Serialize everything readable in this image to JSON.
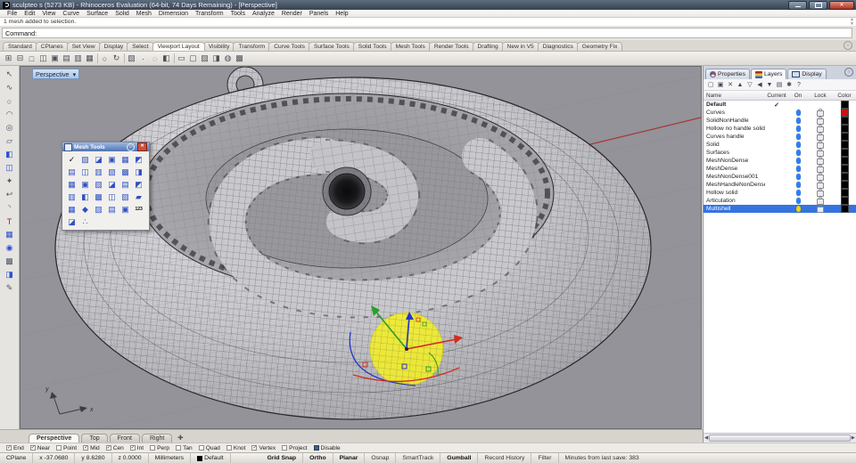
{
  "colors": {
    "selection": "#3574e0",
    "bulb-blue": "#2e7ff0",
    "bulb-yellow": "#ffd400",
    "axis-red": "#a83535",
    "gumball-red": "#d42a1e",
    "gumball-green": "#2a9e2a",
    "gumball-blue": "#2636c8",
    "gumball-yellow": "#f4ef27"
  },
  "window": {
    "title": "sculpteo s (5273 KB) - Rhinoceros Evaluation (64-bit, 74 Days Remaining) - [Perspective]"
  },
  "menu": {
    "items": [
      "File",
      "Edit",
      "View",
      "Curve",
      "Surface",
      "Solid",
      "Mesh",
      "Dimension",
      "Transform",
      "Tools",
      "Analyze",
      "Render",
      "Panels",
      "Help"
    ]
  },
  "command": {
    "history": "1 mesh added to selection.",
    "prompt": "Command:"
  },
  "toolbar_tabs": {
    "items": [
      {
        "label": "Standard"
      },
      {
        "label": "CPlanes"
      },
      {
        "label": "Set View"
      },
      {
        "label": "Display"
      },
      {
        "label": "Select"
      },
      {
        "label": "Viewport Layout",
        "active": true
      },
      {
        "label": "Visibility"
      },
      {
        "label": "Transform"
      },
      {
        "label": "Curve Tools"
      },
      {
        "label": "Surface Tools"
      },
      {
        "label": "Solid Tools"
      },
      {
        "label": "Mesh Tools"
      },
      {
        "label": "Render Tools"
      },
      {
        "label": "Drafting"
      },
      {
        "label": "New in V5"
      },
      {
        "label": "Diagnostics"
      },
      {
        "label": "Geometry Fix"
      }
    ]
  },
  "main_toolbar": {
    "icons": [
      {
        "name": "viewport-layout-4-icon",
        "glyph": "⊞"
      },
      {
        "name": "viewport-layout-3-icon",
        "glyph": "⊟"
      },
      {
        "name": "viewport-single-icon",
        "glyph": "□"
      },
      {
        "name": "viewport-split-vertical-icon",
        "glyph": "◫"
      },
      {
        "name": "viewport-config-icon",
        "glyph": "▣"
      },
      {
        "name": "viewport-rows-icon",
        "glyph": "▤"
      },
      {
        "name": "viewport-columns-icon",
        "glyph": "▥"
      },
      {
        "name": "viewport-grid-icon",
        "glyph": "▦"
      },
      {
        "sep": true
      },
      {
        "name": "shaded-view-icon",
        "glyph": "○"
      },
      {
        "name": "rotate-view-icon",
        "glyph": "↻"
      },
      {
        "sep": true
      },
      {
        "name": "background-image-icon",
        "glyph": "▧"
      },
      {
        "name": "point-icon",
        "glyph": "·"
      },
      {
        "name": "lens-icon",
        "glyph": "◌"
      },
      {
        "name": "camera-icon",
        "glyph": "◧"
      },
      {
        "sep": true
      },
      {
        "name": "named-view-icon",
        "glyph": "▭"
      },
      {
        "name": "new-viewport-icon",
        "glyph": "▢"
      },
      {
        "name": "plan-view-icon",
        "glyph": "▨"
      },
      {
        "name": "page-setup-icon",
        "glyph": "◨"
      },
      {
        "name": "zoom-lens-icon",
        "glyph": "◍"
      },
      {
        "name": "print-icon",
        "glyph": "▩"
      }
    ]
  },
  "left_toolbar": {
    "icons": [
      {
        "name": "select-arrow-icon",
        "glyph": "↖"
      },
      {
        "name": "control-point-curve-icon",
        "glyph": "∿"
      },
      {
        "name": "circle-icon",
        "glyph": "○"
      },
      {
        "name": "arc-icon",
        "glyph": "◠"
      },
      {
        "name": "ellipse-icon",
        "glyph": "◎"
      },
      {
        "name": "surface-icon",
        "glyph": "▱"
      },
      {
        "name": "box-icon",
        "glyph": "◧",
        "blue": true
      },
      {
        "name": "cylinder-icon",
        "glyph": "◫",
        "blue": true
      },
      {
        "name": "extrude-icon",
        "glyph": "✦"
      },
      {
        "name": "join-icon",
        "glyph": "↩"
      },
      {
        "name": "blend-arc-icon",
        "glyph": "◝"
      },
      {
        "name": "text-icon",
        "glyph": "T",
        "red": true
      },
      {
        "name": "mesh-icon",
        "glyph": "▦",
        "blue": true
      },
      {
        "name": "render-sphere-icon",
        "glyph": "◉",
        "blue": true
      },
      {
        "name": "grid-icon",
        "glyph": "▩"
      },
      {
        "name": "solid-tools-icon",
        "glyph": "◨",
        "blue": true
      },
      {
        "name": "annotate-icon",
        "glyph": "✎"
      }
    ]
  },
  "viewport": {
    "label": "Perspective",
    "dropdown_glyph": "▾",
    "tabs": [
      {
        "label": "Perspective",
        "active": true
      },
      {
        "label": "Top"
      },
      {
        "label": "Front"
      },
      {
        "label": "Right"
      }
    ],
    "nav_glyph": "✚"
  },
  "mesh_palette": {
    "title": "Mesh Tools",
    "icons": [
      {
        "glyph": "✓",
        "black": true
      },
      {
        "glyph": "▨"
      },
      {
        "glyph": "◪"
      },
      {
        "glyph": "▣"
      },
      {
        "glyph": "▦"
      },
      {
        "glyph": "◩"
      },
      {
        "glyph": "▤"
      },
      {
        "glyph": "◫"
      },
      {
        "glyph": "▥"
      },
      {
        "glyph": "▧"
      },
      {
        "glyph": "▩"
      },
      {
        "glyph": "◨"
      },
      {
        "glyph": "▦"
      },
      {
        "glyph": "▣"
      },
      {
        "glyph": "▨"
      },
      {
        "glyph": "◪"
      },
      {
        "glyph": "▤"
      },
      {
        "glyph": "◩"
      },
      {
        "glyph": "▥"
      },
      {
        "glyph": "◧"
      },
      {
        "glyph": "▩"
      },
      {
        "glyph": "◫"
      },
      {
        "glyph": "▧"
      },
      {
        "glyph": "▰"
      },
      {
        "glyph": "▦"
      },
      {
        "glyph": "◆"
      },
      {
        "glyph": "▨"
      },
      {
        "glyph": "▤"
      },
      {
        "glyph": "▣"
      },
      {
        "glyph": "123",
        "num": true
      },
      {
        "glyph": "◪"
      },
      {
        "glyph": "∴"
      }
    ]
  },
  "panels": {
    "tabs": [
      {
        "label": "Properties",
        "name": "tab-properties"
      },
      {
        "label": "Layers",
        "active": true,
        "name": "tab-layers"
      },
      {
        "label": "Display",
        "name": "tab-display"
      }
    ],
    "layers": {
      "toolbar": [
        {
          "name": "new-layer-icon",
          "glyph": "▢"
        },
        {
          "name": "new-sublayer-icon",
          "glyph": "▣"
        },
        {
          "name": "delete-layer-icon",
          "glyph": "✕"
        },
        {
          "name": "move-up-icon",
          "glyph": "▲"
        },
        {
          "name": "move-down-icon",
          "glyph": "▽"
        },
        {
          "name": "collapse-icon",
          "glyph": "◀"
        },
        {
          "name": "filter-icon",
          "glyph": "▼"
        },
        {
          "name": "layer-list-icon",
          "glyph": "▤"
        },
        {
          "name": "layer-tools-icon",
          "glyph": "✱"
        },
        {
          "name": "help-icon",
          "glyph": "?"
        }
      ],
      "columns": [
        "Name",
        "Current",
        "On",
        "Lock",
        "Color"
      ],
      "rows": [
        {
          "name_label": "Default",
          "bold": true,
          "current": true,
          "bulb": false,
          "lock": false,
          "color": "#000000"
        },
        {
          "name_label": "Curves",
          "bulb": "#2e7ff0",
          "color": "#cc1111"
        },
        {
          "name_label": "SolidNonHandle",
          "bulb": "#2e7ff0",
          "color": "#000000"
        },
        {
          "name_label": "Hollow no handle solid",
          "bulb": "#2e7ff0",
          "color": "#000000"
        },
        {
          "name_label": "Curves handle",
          "bulb": "#2e7ff0",
          "color": "#000000"
        },
        {
          "name_label": "Solid",
          "bulb": "#2e7ff0",
          "color": "#000000"
        },
        {
          "name_label": "Surfaces",
          "bulb": "#2e7ff0",
          "color": "#000000"
        },
        {
          "name_label": "MeshNonDense",
          "bulb": "#2e7ff0",
          "color": "#000000"
        },
        {
          "name_label": "MeshDense",
          "bulb": "#2e7ff0",
          "color": "#000000"
        },
        {
          "name_label": "MeshNonDense001",
          "bulb": "#2e7ff0",
          "color": "#000000"
        },
        {
          "name_label": "MeshHandleNonDense",
          "bulb": "#2e7ff0",
          "color": "#000000"
        },
        {
          "name_label": "Hollow solid",
          "bulb": "#2e7ff0",
          "color": "#000000"
        },
        {
          "name_label": "Articulation",
          "bulb": "#2e7ff0",
          "color": "#000000"
        },
        {
          "name_label": "Multishell",
          "selected": true,
          "bulb": "#ffd400",
          "color": "#000000"
        }
      ]
    }
  },
  "osnap": {
    "items": [
      {
        "label": "End",
        "checked": true
      },
      {
        "label": "Near",
        "checked": true
      },
      {
        "label": "Point"
      },
      {
        "label": "Mid",
        "checked": true
      },
      {
        "label": "Cen",
        "checked": true
      },
      {
        "label": "Int",
        "checked": true
      },
      {
        "label": "Perp"
      },
      {
        "label": "Tan"
      },
      {
        "label": "Quad"
      },
      {
        "label": "Knot"
      },
      {
        "label": "Vertex",
        "checked": true
      },
      {
        "label": "Project"
      },
      {
        "label": "Disable",
        "dark": true
      }
    ]
  },
  "status_bar": {
    "left": [
      {
        "label": "CPlane"
      },
      {
        "label": "x -37.0680"
      },
      {
        "label": "y 8.6280"
      },
      {
        "label": "z 0.0000"
      },
      {
        "label": "Millimeters"
      },
      {
        "label": "Default",
        "swatch-seg": true
      }
    ],
    "toggles": [
      {
        "label": "Grid Snap",
        "bold": true
      },
      {
        "label": "Ortho",
        "bold": true
      },
      {
        "label": "Planar",
        "bold": true
      },
      {
        "label": "Osnap"
      },
      {
        "label": "SmartTrack"
      },
      {
        "label": "Gumball",
        "bold": true
      },
      {
        "label": "Record History"
      },
      {
        "label": "Filter"
      },
      {
        "label": "Minutes from last save: 383",
        "grow": true
      }
    ]
  }
}
